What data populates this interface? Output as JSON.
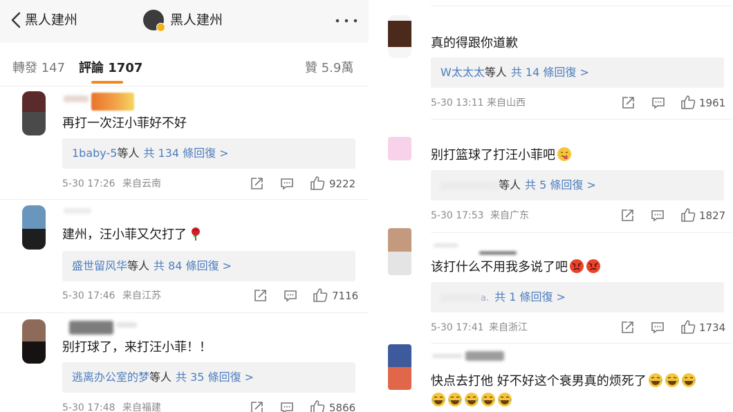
{
  "header": {
    "back_label": "黑人建州",
    "title": "黑人建州"
  },
  "tabs": {
    "repost": "轉發 147",
    "comment": "評論 1707",
    "like": "贊 5.9萬"
  },
  "left_comments": [
    {
      "text": "再打一次汪小菲好不好",
      "reply_users": "1baby-5",
      "reply_mid": "等人",
      "reply_count": "共 134 條回復 >",
      "time": "5-30 17:26",
      "source": "来自云南",
      "likes": "9222"
    },
    {
      "text": "建州，汪小菲又欠打了",
      "emoji": "rose",
      "reply_users": "盛世留风华",
      "reply_mid": "等人",
      "reply_count": "共 84 條回復 >",
      "time": "5-30 17:46",
      "source": "来自江苏",
      "likes": "7116"
    },
    {
      "text": "别打球了，来打汪小菲！！",
      "reply_users": "逃离办公室的梦",
      "reply_mid": "等人",
      "reply_count": "共 35 條回復 >",
      "time": "5-30 17:48",
      "source": "来自福建",
      "likes": "5866"
    }
  ],
  "right_comments": [
    {
      "text": "真的得跟你道歉",
      "reply_users": "W太太太",
      "reply_mid": "等人",
      "reply_count": "共 14 條回復 >",
      "time": "5-30 13:11",
      "source": "来自山西",
      "likes": "1961"
    },
    {
      "text": "别打篮球了打汪小菲吧",
      "emoji": "tongue-face",
      "reply_users": "",
      "reply_mid": "等人",
      "reply_count": "共 5 條回復 >",
      "time": "5-30 17:53",
      "source": "来自广东",
      "likes": "1827"
    },
    {
      "text": "该打什么不用我多说了吧",
      "emoji": "angry-face",
      "reply_users": "",
      "reply_mid": "a.",
      "reply_count": "共 1 條回復 >",
      "time": "5-30 17:41",
      "source": "来自浙江",
      "likes": "1734"
    },
    {
      "text": "快点去打他 好不好这个衰男真的烦死了",
      "emoji": "laugh-cry-face"
    }
  ],
  "colors": {
    "accent": "#f28a1c",
    "link": "#4d7dbf",
    "reply_bg": "#f2f2f2",
    "meta": "#8a8a8a"
  }
}
